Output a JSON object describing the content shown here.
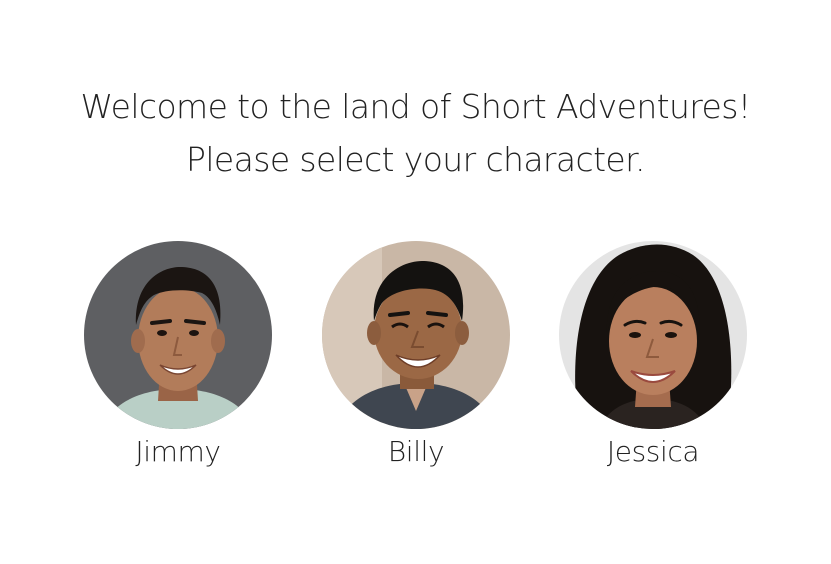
{
  "headline": {
    "line1": "Welcome to the land of Short Adventures!",
    "line2": "Please select your character."
  },
  "characters": [
    {
      "name": "Jimmy",
      "icon": "portrait-man-icon",
      "colors": {
        "background": "#5e5f62",
        "skin": "#b27c5a",
        "hair": "#1b1512",
        "shirt": "#b9cfc6"
      }
    },
    {
      "name": "Billy",
      "icon": "portrait-man-icon",
      "colors": {
        "background": "#c9b7a6",
        "skin": "#9b6845",
        "hair": "#141210",
        "shirt": "#3f4650"
      }
    },
    {
      "name": "Jessica",
      "icon": "portrait-woman-icon",
      "colors": {
        "background": "#e4e4e4",
        "skin": "#b97f5e",
        "hair": "#17120f",
        "shirt": "#2a2320"
      }
    }
  ]
}
